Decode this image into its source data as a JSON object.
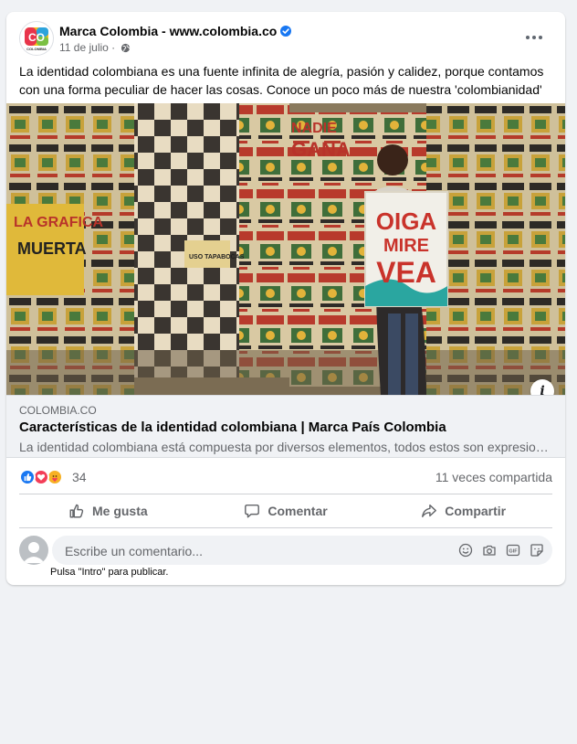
{
  "post": {
    "page_name": "Marca Colombia - www.colombia.co",
    "date": "11 de julio",
    "separator": "·",
    "text": "La identidad colombiana es una fuente infinita de alegría, pasión y calidez, porque contamos con una forma peculiar de hacer las cosas. Conoce un poco más de nuestra 'colombianidad' aquí:",
    "avatar_text": "CO",
    "avatar_subtext": "COLOMBIA"
  },
  "image": {
    "sign_lines": [
      "OIGA",
      "MIRE",
      "VEA"
    ],
    "poster_words": [
      "NADIE",
      "GANA",
      "LA GRAFICA",
      "MUERTA",
      "USO TAPABOCAS"
    ]
  },
  "link": {
    "domain": "COLOMBIA.CO",
    "title": "Características de la identidad colombiana | Marca País Colombia",
    "description": "La identidad colombiana está compuesta por diversos elementos, todos estos son expresiones..."
  },
  "stats": {
    "reaction_count": "34",
    "shares": "11 veces compartida",
    "reactions": [
      "like-icon",
      "love-icon",
      "care-icon"
    ]
  },
  "actions": {
    "like": "Me gusta",
    "comment": "Comentar",
    "share": "Compartir"
  },
  "comment": {
    "placeholder": "Escribe un comentario...",
    "hint": "Pulsa \"Intro\" para publicar."
  },
  "colors": {
    "facebook_blue": "#1877f2",
    "love_red": "#f33e58",
    "care_yellow": "#f7b125"
  }
}
